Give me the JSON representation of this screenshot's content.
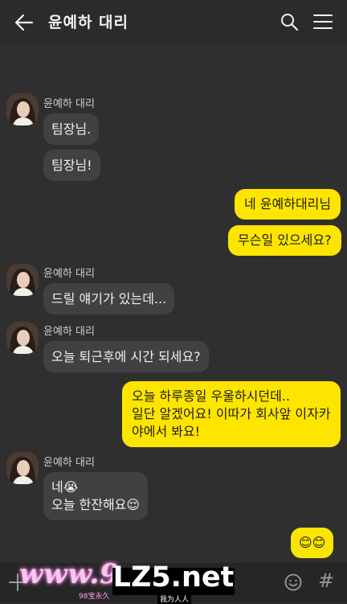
{
  "header": {
    "title": "윤예하 대리",
    "back_icon": "arrow-left-icon",
    "search_icon": "search-icon",
    "menu_icon": "hamburger-menu-icon"
  },
  "messages": [
    {
      "sender": "윤예하 대리",
      "text": "팀장님."
    },
    {
      "text": "팀장님!"
    },
    {
      "text": "네 윤예하대리님",
      "mine": true
    },
    {
      "text": "무슨일 있으세요?",
      "mine": true
    },
    {
      "sender": "윤예하 대리",
      "text": "드릴 얘기가 있는데..."
    },
    {
      "sender": "윤예하 대리",
      "text": "오늘 퇴근후에 시간 되세요?"
    },
    {
      "mine": true,
      "lines": [
        "오늘 하루종일 우울하시던데..",
        "일단 알겠어요! 이따가 회사앞 이자카",
        "야에서 봐요!"
      ]
    },
    {
      "sender": "윤예하 대리",
      "lines": [
        "네😭",
        "오늘 한잔해요😌"
      ]
    },
    {
      "mine": true,
      "text": "😊😊"
    }
  ],
  "footer": {
    "plus_icon": "plus-icon",
    "emoji_icon": "emoji-smile-icon",
    "hash_label": "#"
  },
  "watermarks": {
    "left": "www.9",
    "left_sub": "98宝永久",
    "right": "LZ5.net",
    "right_sub": "我为人人"
  },
  "colors": {
    "background": "#2f2f2f",
    "incoming_bubble": "#414141",
    "outgoing_bubble": "#fee500"
  }
}
